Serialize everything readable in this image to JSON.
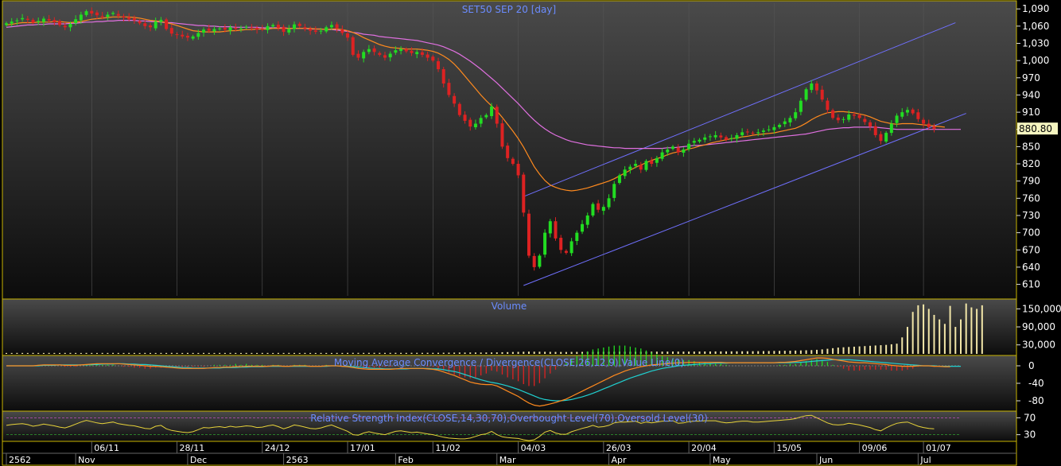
{
  "colors": {
    "up": "#22dd22",
    "down": "#dd2222",
    "ma_fast": "#ff8a1e",
    "ma_slow": "#e070e0",
    "channel": "#7070ff",
    "volume": "#f2e6a8",
    "macd": "#ff8a1e",
    "signal": "#20d0d0",
    "rsi": "#e6d23a",
    "panel_title": "#6b8cff",
    "axis_text": "#ffffff",
    "price_tag_bg": "#f5f5c0",
    "border": "#c8b400"
  },
  "chart_data": [
    {
      "type": "candlestick",
      "title": "SET50 SEP 20   [day]",
      "ylim": [
        590,
        1100
      ],
      "y_ticks": [
        "1,090",
        "1,060",
        "1,030",
        "1,000",
        "970",
        "940",
        "910",
        "880",
        "850",
        "820",
        "790",
        "760",
        "730",
        "700",
        "670",
        "640",
        "610"
      ],
      "y_tick_values": [
        1090,
        1060,
        1030,
        1000,
        970,
        940,
        910,
        880,
        850,
        820,
        790,
        760,
        730,
        700,
        670,
        640,
        610
      ],
      "last_price": "880.80",
      "last_price_value": 880.8,
      "x_date_labels": [
        "06/11",
        "28/11",
        "24/12",
        "17/01",
        "11/02",
        "04/03",
        "26/03",
        "20/04",
        "15/05",
        "09/06",
        "01/07"
      ],
      "x_date_label_bars": [
        16,
        32,
        48,
        64,
        80,
        96,
        112,
        128,
        144,
        160,
        172
      ],
      "x_month_labels": [
        "2562",
        "Nov",
        "Dec",
        "2563",
        "Feb",
        "Mar",
        "Apr",
        "May",
        "Jun",
        "Jul"
      ],
      "x_month_label_bars": [
        0,
        13,
        34,
        52,
        73,
        92,
        113,
        132,
        152,
        171
      ],
      "bar_count": 180,
      "close": [
        1065,
        1068,
        1070,
        1074,
        1071,
        1066,
        1069,
        1073,
        1070,
        1067,
        1062,
        1058,
        1064,
        1072,
        1080,
        1086,
        1082,
        1079,
        1076,
        1080,
        1083,
        1078,
        1075,
        1072,
        1070,
        1065,
        1060,
        1058,
        1068,
        1071,
        1055,
        1047,
        1045,
        1042,
        1040,
        1042,
        1048,
        1054,
        1052,
        1055,
        1056,
        1054,
        1058,
        1055,
        1056,
        1059,
        1057,
        1054,
        1055,
        1060,
        1062,
        1057,
        1050,
        1055,
        1063,
        1060,
        1056,
        1052,
        1050,
        1052,
        1058,
        1062,
        1056,
        1048,
        1040,
        1010,
        1005,
        1015,
        1020,
        1015,
        1010,
        1005,
        1012,
        1018,
        1020,
        1016,
        1013,
        1015,
        1010,
        1005,
        1000,
        985,
        960,
        940,
        925,
        905,
        895,
        885,
        890,
        900,
        905,
        920,
        890,
        850,
        830,
        820,
        800,
        735,
        660,
        640,
        660,
        700,
        720,
        690,
        670,
        665,
        685,
        700,
        715,
        730,
        750,
        740,
        745,
        760,
        785,
        800,
        810,
        815,
        820,
        810,
        825,
        820,
        830,
        840,
        845,
        850,
        840,
        845,
        855,
        860,
        862,
        866,
        868,
        870,
        866,
        862,
        865,
        870,
        875,
        876,
        874,
        875,
        878,
        880,
        884,
        888,
        894,
        900,
        910,
        930,
        950,
        960,
        948,
        932,
        914,
        900,
        896,
        898,
        906,
        904,
        900,
        893,
        885,
        870,
        860,
        874,
        890,
        904,
        910,
        914,
        908,
        898,
        890,
        884,
        880.8
      ],
      "ma_fast": [
        1062,
        1063,
        1065,
        1066,
        1066,
        1066,
        1067,
        1067,
        1067,
        1068,
        1068,
        1067,
        1066,
        1067,
        1068,
        1070,
        1072,
        1073,
        1074,
        1075,
        1076,
        1076,
        1076,
        1076,
        1075,
        1074,
        1072,
        1070,
        1069,
        1068,
        1066,
        1064,
        1061,
        1058,
        1055,
        1052,
        1051,
        1050,
        1050,
        1050,
        1050,
        1051,
        1052,
        1052,
        1053,
        1054,
        1054,
        1055,
        1055,
        1055,
        1056,
        1056,
        1056,
        1056,
        1056,
        1056,
        1056,
        1056,
        1055,
        1055,
        1054,
        1055,
        1055,
        1054,
        1052,
        1049,
        1045,
        1040,
        1036,
        1032,
        1028,
        1025,
        1023,
        1022,
        1021,
        1020,
        1020,
        1020,
        1019,
        1018,
        1016,
        1013,
        1008,
        1002,
        994,
        984,
        973,
        962,
        951,
        940,
        930,
        921,
        912,
        901,
        889,
        877,
        864,
        849,
        832,
        815,
        802,
        791,
        783,
        779,
        776,
        774,
        773,
        774,
        776,
        778,
        781,
        784,
        787,
        790,
        794,
        799,
        804,
        809,
        814,
        818,
        822,
        826,
        829,
        832,
        836,
        839,
        841,
        843,
        846,
        848,
        851,
        853,
        856,
        858,
        860,
        862,
        864,
        865,
        867,
        868,
        870,
        871,
        872,
        873,
        874,
        876,
        878,
        880,
        882,
        886,
        891,
        897,
        902,
        906,
        909,
        910,
        911,
        911,
        910,
        909,
        907,
        905,
        902,
        898,
        894,
        892,
        890,
        889,
        890,
        890,
        890,
        889,
        888,
        887,
        886,
        885,
        884
      ],
      "ma_slow": [
        1058,
        1059,
        1060,
        1061,
        1062,
        1062,
        1063,
        1063,
        1064,
        1064,
        1064,
        1064,
        1065,
        1065,
        1066,
        1067,
        1067,
        1068,
        1068,
        1069,
        1069,
        1070,
        1070,
        1070,
        1070,
        1069,
        1069,
        1068,
        1068,
        1067,
        1066,
        1066,
        1065,
        1064,
        1063,
        1062,
        1061,
        1061,
        1060,
        1060,
        1059,
        1059,
        1059,
        1058,
        1058,
        1058,
        1058,
        1058,
        1057,
        1057,
        1057,
        1057,
        1057,
        1056,
        1056,
        1056,
        1056,
        1055,
        1055,
        1055,
        1054,
        1054,
        1053,
        1052,
        1051,
        1049,
        1048,
        1046,
        1045,
        1044,
        1042,
        1041,
        1040,
        1039,
        1038,
        1037,
        1036,
        1035,
        1033,
        1031,
        1029,
        1027,
        1024,
        1020,
        1016,
        1011,
        1005,
        999,
        992,
        985,
        977,
        969,
        961,
        952,
        943,
        934,
        925,
        915,
        905,
        896,
        888,
        881,
        875,
        870,
        866,
        862,
        859,
        857,
        855,
        853,
        852,
        851,
        850,
        849,
        848,
        848,
        847,
        847,
        847,
        847,
        847,
        847,
        847,
        847,
        848,
        848,
        849,
        850,
        851,
        852,
        852,
        853,
        854,
        855,
        856,
        857,
        858,
        859,
        860,
        861,
        862,
        863,
        864,
        865,
        866,
        867,
        868,
        869,
        870,
        871,
        872,
        874,
        876,
        878,
        880,
        881,
        882,
        883,
        883,
        884,
        884,
        884,
        884,
        884,
        883,
        882,
        881,
        880,
        880,
        880,
        880,
        880,
        880,
        880,
        880,
        880,
        880,
        880,
        880,
        880
      ],
      "channel_lines": [
        {
          "name": "channel-upper",
          "points": [
            [
              97,
              763
            ],
            [
              178,
              1066
            ]
          ]
        },
        {
          "name": "channel-lower",
          "points": [
            [
              97,
              608
            ],
            [
              180,
              908
            ]
          ]
        }
      ]
    },
    {
      "type": "bar",
      "title": "Volume",
      "ylim": [
        0,
        175000
      ],
      "y_ticks": [
        "150,000",
        "90,000",
        "30,000"
      ],
      "y_tick_values": [
        150000,
        90000,
        30000
      ],
      "values": [
        3000,
        3000,
        3200,
        3100,
        3000,
        3300,
        3100,
        3000,
        3200,
        3100,
        3000,
        3200,
        3300,
        3100,
        3000,
        3200,
        3100,
        3000,
        3200,
        3100,
        3300,
        3100,
        3000,
        3200,
        3100,
        3000,
        3200,
        3100,
        3000,
        3200,
        3100,
        3300,
        3100,
        3000,
        3200,
        3100,
        3000,
        3200,
        3100,
        3000,
        3200,
        3100,
        3300,
        3100,
        3000,
        3200,
        3100,
        3000,
        3200,
        3100,
        3000,
        3200,
        3100,
        3300,
        3100,
        3000,
        3200,
        3100,
        3000,
        3200,
        3100,
        3000,
        3200,
        3100,
        3300,
        3500,
        3400,
        3300,
        3400,
        3500,
        3400,
        3300,
        3400,
        3500,
        3400,
        3300,
        3600,
        3500,
        3400,
        3600,
        3500,
        3600,
        3800,
        4000,
        4200,
        4500,
        4300,
        4600,
        4500,
        4400,
        4600,
        4800,
        5000,
        5500,
        5800,
        6200,
        6500,
        7000,
        7500,
        7200,
        7000,
        6800,
        6600,
        6400,
        6300,
        6200,
        6400,
        6500,
        6600,
        6700,
        6800,
        6900,
        7000,
        7100,
        7200,
        7300,
        7200,
        7100,
        7000,
        7100,
        7200,
        7300,
        7400,
        7500,
        7600,
        7700,
        7600,
        7500,
        7600,
        7700,
        7800,
        7900,
        8000,
        8100,
        8200,
        8300,
        8400,
        8500,
        8600,
        8700,
        8800,
        9000,
        9200,
        9500,
        9800,
        10000,
        10300,
        10600,
        11000,
        11500,
        12000,
        12500,
        13500,
        15000,
        17000,
        19000,
        21000,
        22000,
        23000,
        24000,
        25000,
        26000,
        27000,
        28000,
        29000,
        30000,
        32000,
        34000,
        55000,
        90000,
        140000,
        162000,
        165000,
        150000,
        130000,
        115000,
        100000,
        160000,
        90000,
        115000,
        168000,
        155000,
        150000,
        162000
      ],
      "zero_level": 0
    },
    {
      "type": "line",
      "title": "Moving Average Convergence / Divergence(CLOSE,26,12,9),Value Line(0)",
      "ylim": [
        -100,
        20
      ],
      "y_ticks": [
        "0",
        "-40",
        "-80"
      ],
      "y_tick_values": [
        0,
        -40,
        -80
      ],
      "macd": [
        0,
        0,
        0,
        0,
        0,
        0,
        1,
        2,
        2,
        2,
        2,
        1,
        1,
        1,
        2,
        3,
        4,
        5,
        5,
        5,
        5,
        5,
        4,
        3,
        2,
        1,
        0,
        -1,
        -1,
        -2,
        -3,
        -4,
        -5,
        -6,
        -6,
        -6,
        -6,
        -6,
        -5,
        -4,
        -4,
        -3,
        -3,
        -2,
        -2,
        -1,
        -1,
        -1,
        -1,
        -1,
        0,
        0,
        -1,
        -1,
        0,
        0,
        0,
        -1,
        -1,
        -1,
        0,
        0,
        0,
        -1,
        -2,
        -4,
        -6,
        -7,
        -8,
        -8,
        -8,
        -8,
        -8,
        -7,
        -6,
        -6,
        -6,
        -6,
        -6,
        -7,
        -8,
        -10,
        -14,
        -18,
        -22,
        -27,
        -32,
        -37,
        -40,
        -42,
        -43,
        -43,
        -46,
        -52,
        -58,
        -64,
        -70,
        -78,
        -85,
        -90,
        -92,
        -90,
        -87,
        -84,
        -80,
        -76,
        -70,
        -64,
        -58,
        -52,
        -46,
        -40,
        -34,
        -28,
        -22,
        -17,
        -12,
        -8,
        -5,
        -2,
        0,
        2,
        3,
        4,
        5,
        6,
        7,
        7,
        8,
        8,
        8,
        8,
        8,
        8,
        8,
        7,
        7,
        7,
        7,
        7,
        7,
        7,
        7,
        7,
        7,
        8,
        8,
        9,
        10,
        12,
        14,
        16,
        18,
        18,
        17,
        15,
        13,
        11,
        9,
        8,
        7,
        7,
        6,
        5,
        4,
        3,
        1,
        0,
        -1,
        -1,
        -1,
        0,
        0,
        0,
        -1,
        -1,
        -2,
        -2
      ],
      "signal": [
        0,
        0,
        0,
        0,
        0,
        0,
        0,
        1,
        1,
        1,
        2,
        2,
        2,
        2,
        2,
        2,
        3,
        3,
        4,
        4,
        4,
        5,
        5,
        4,
        4,
        3,
        3,
        2,
        1,
        0,
        -1,
        -2,
        -3,
        -4,
        -4,
        -5,
        -5,
        -5,
        -5,
        -5,
        -5,
        -4,
        -4,
        -4,
        -3,
        -3,
        -2,
        -2,
        -2,
        -1,
        -1,
        -1,
        -1,
        -1,
        -1,
        -1,
        -1,
        -1,
        -1,
        -1,
        -1,
        0,
        0,
        -1,
        -1,
        -2,
        -3,
        -4,
        -5,
        -6,
        -6,
        -7,
        -7,
        -7,
        -7,
        -7,
        -6,
        -6,
        -6,
        -6,
        -7,
        -7,
        -9,
        -11,
        -13,
        -16,
        -20,
        -24,
        -28,
        -32,
        -35,
        -38,
        -40,
        -43,
        -46,
        -50,
        -54,
        -59,
        -64,
        -69,
        -74,
        -77,
        -79,
        -80,
        -80,
        -79,
        -77,
        -74,
        -71,
        -67,
        -63,
        -58,
        -53,
        -48,
        -43,
        -38,
        -33,
        -28,
        -24,
        -20,
        -16,
        -12,
        -9,
        -6,
        -4,
        -2,
        0,
        1,
        2,
        3,
        4,
        5,
        5,
        6,
        6,
        6,
        7,
        7,
        7,
        7,
        7,
        7,
        7,
        7,
        7,
        7,
        7,
        7,
        8,
        8,
        9,
        10,
        11,
        12,
        13,
        14,
        14,
        14,
        14,
        13,
        12,
        11,
        10,
        9,
        8,
        7,
        6,
        5,
        4,
        3,
        2,
        1,
        0,
        0,
        0,
        -1,
        -1,
        -1,
        -1,
        -1
      ],
      "zero_level": 0
    },
    {
      "type": "line",
      "title": "Relative Strength Index(CLOSE,14,30,70),Overbought Level(70),Oversold Level(30)",
      "ylim": [
        18,
        82
      ],
      "y_ticks": [
        "70",
        "30"
      ],
      "y_tick_values": [
        70,
        30
      ],
      "overbought": 70,
      "oversold": 30,
      "values": [
        52,
        54,
        55,
        56,
        54,
        50,
        52,
        55,
        53,
        51,
        48,
        46,
        50,
        55,
        60,
        64,
        61,
        58,
        56,
        58,
        60,
        56,
        54,
        52,
        51,
        48,
        45,
        44,
        50,
        52,
        44,
        40,
        38,
        36,
        35,
        37,
        42,
        47,
        46,
        48,
        49,
        47,
        50,
        48,
        49,
        51,
        50,
        47,
        48,
        51,
        53,
        49,
        44,
        48,
        53,
        51,
        48,
        45,
        44,
        46,
        50,
        53,
        48,
        43,
        38,
        30,
        29,
        34,
        37,
        34,
        32,
        30,
        34,
        38,
        39,
        37,
        35,
        36,
        34,
        32,
        30,
        27,
        24,
        22,
        21,
        20,
        20,
        22,
        26,
        30,
        32,
        38,
        30,
        25,
        23,
        22,
        21,
        18,
        16,
        18,
        26,
        36,
        40,
        34,
        31,
        31,
        37,
        41,
        45,
        48,
        52,
        48,
        49,
        52,
        58,
        60,
        60,
        61,
        62,
        57,
        60,
        58,
        60,
        62,
        62,
        63,
        57,
        58,
        61,
        62,
        62,
        63,
        63,
        63,
        60,
        58,
        59,
        61,
        62,
        62,
        60,
        60,
        61,
        62,
        63,
        64,
        65,
        66,
        68,
        72,
        75,
        76,
        70,
        64,
        58,
        54,
        53,
        54,
        57,
        55,
        53,
        50,
        47,
        42,
        39,
        46,
        52,
        57,
        59,
        60,
        55,
        50,
        47,
        45,
        44
      ]
    }
  ]
}
